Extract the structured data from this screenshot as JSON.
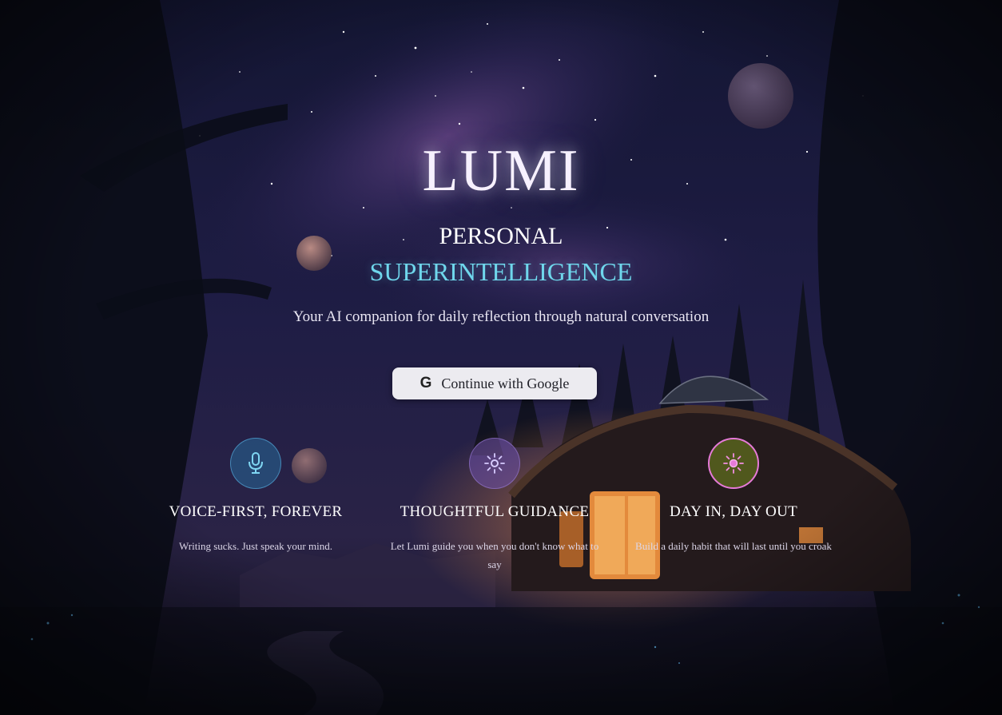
{
  "hero": {
    "wordmark": "LUMI",
    "tagline_line1": "PERSONAL",
    "tagline_line2": "SUPERINTELLIGENCE",
    "subtitle": "Your AI companion for daily reflection through natural conversation"
  },
  "auth": {
    "google_icon_glyph": "G",
    "google_button_label": "Continue with Google"
  },
  "features": [
    {
      "icon": "microphone-icon",
      "title": "VOICE-FIRST, FOREVER",
      "description": "Writing sucks. Just speak your mind."
    },
    {
      "icon": "sun-icon",
      "title": "THOUGHTFUL GUIDANCE",
      "description": "Let Lumi guide you when you don't know what to say"
    },
    {
      "icon": "sun-icon",
      "title": "DAY IN, DAY OUT",
      "description": "Build a daily habit that will last until you croak"
    }
  ],
  "colors": {
    "accent_cyan": "#6fd7ec",
    "button_bg": "#ecebf0",
    "icon_pink": "#e67ad8",
    "night_bg": "#0c0d1a"
  }
}
